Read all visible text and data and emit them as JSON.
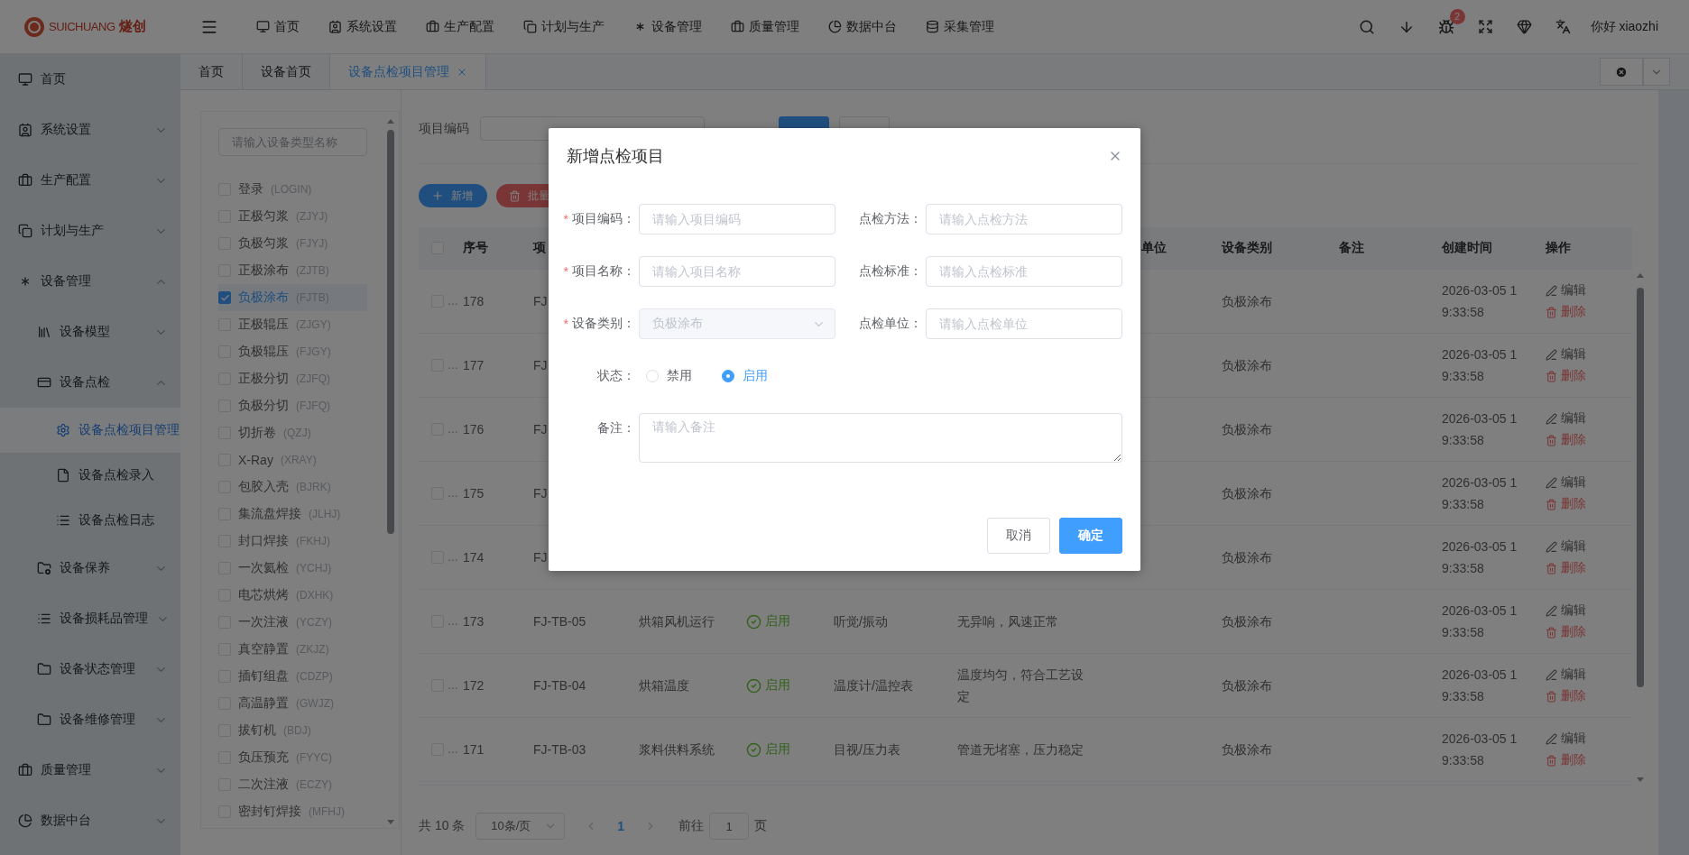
{
  "header": {
    "logo": {
      "latin": "SUICHUANG",
      "cjk": "燧创"
    },
    "nav": [
      "首页",
      "系统设置",
      "生产配置",
      "计划与生产",
      "设备管理",
      "质量管理",
      "数据中台",
      "采集管理"
    ],
    "notification_count": "2",
    "greeting": "你好 xiaozhi"
  },
  "sidebar": {
    "items": [
      {
        "label": "首页",
        "selected": false
      },
      {
        "label": "系统设置",
        "expanded": false,
        "selected": false
      },
      {
        "label": "生产配置",
        "expanded": false,
        "selected": false
      },
      {
        "label": "计划与生产",
        "expanded": false,
        "selected": false
      },
      {
        "label": "设备管理",
        "expanded": true,
        "selected": false,
        "children": [
          {
            "label": "设备模型",
            "expanded": false,
            "selected": false
          },
          {
            "label": "设备点检",
            "expanded": true,
            "selected": false,
            "children": [
              {
                "label": "设备点检项目管理",
                "selected": true
              },
              {
                "label": "设备点检录入",
                "selected": false
              },
              {
                "label": "设备点检日志",
                "selected": false
              }
            ]
          },
          {
            "label": "设备保养",
            "expanded": false,
            "selected": false
          },
          {
            "label": "设备损耗品管理",
            "expanded": false,
            "selected": false
          },
          {
            "label": "设备状态管理",
            "expanded": false,
            "selected": false
          },
          {
            "label": "设备维修管理",
            "expanded": false,
            "selected": false
          }
        ]
      },
      {
        "label": "质量管理",
        "expanded": false,
        "selected": false
      },
      {
        "label": "数据中台",
        "expanded": false,
        "selected": false
      }
    ]
  },
  "tabs": [
    {
      "label": "首页",
      "selected": false,
      "closable": false
    },
    {
      "label": "设备首页",
      "selected": false,
      "closable": false
    },
    {
      "label": "设备点检项目管理",
      "selected": true,
      "closable": true
    }
  ],
  "category_tree": {
    "search": {
      "placeholder": "请输入设备类型名称"
    },
    "items": [
      {
        "name": "登录",
        "code": "(LOGIN)",
        "checked": false,
        "selected": false
      },
      {
        "name": "正极匀浆",
        "code": "(ZJYJ)",
        "checked": false,
        "selected": false
      },
      {
        "name": "负极匀浆",
        "code": "(FJYJ)",
        "checked": false,
        "selected": false
      },
      {
        "name": "正极涂布",
        "code": "(ZJTB)",
        "checked": false,
        "selected": false
      },
      {
        "name": "负极涂布",
        "code": "(FJTB)",
        "checked": true,
        "selected": true
      },
      {
        "name": "正极辊压",
        "code": "(ZJGY)",
        "checked": false,
        "selected": false
      },
      {
        "name": "负极辊压",
        "code": "(FJGY)",
        "checked": false,
        "selected": false
      },
      {
        "name": "正极分切",
        "code": "(ZJFQ)",
        "checked": false,
        "selected": false
      },
      {
        "name": "负极分切",
        "code": "(FJFQ)",
        "checked": false,
        "selected": false
      },
      {
        "name": "切折卷",
        "code": "(QZJ)",
        "checked": false,
        "selected": false
      },
      {
        "name": "X-Ray",
        "code": "(XRAY)",
        "checked": false,
        "selected": false
      },
      {
        "name": "包胶入壳",
        "code": "(BJRK)",
        "checked": false,
        "selected": false
      },
      {
        "name": "集流盘焊接",
        "code": "(JLHJ)",
        "checked": false,
        "selected": false
      },
      {
        "name": "封口焊接",
        "code": "(FKHJ)",
        "checked": false,
        "selected": false
      },
      {
        "name": "一次氦检",
        "code": "(YCHJ)",
        "checked": false,
        "selected": false
      },
      {
        "name": "电芯烘烤",
        "code": "(DXHK)",
        "checked": false,
        "selected": false
      },
      {
        "name": "一次注液",
        "code": "(YCZY)",
        "checked": false,
        "selected": false
      },
      {
        "name": "真空静置",
        "code": "(ZKJZ)",
        "checked": false,
        "selected": false
      },
      {
        "name": "插钉组盘",
        "code": "(CDZP)",
        "checked": false,
        "selected": false
      },
      {
        "name": "高温静置",
        "code": "(GWJZ)",
        "checked": false,
        "selected": false
      },
      {
        "name": "拔钉机",
        "code": "(BDJ)",
        "checked": false,
        "selected": false
      },
      {
        "name": "负压预充",
        "code": "(FYYC)",
        "checked": false,
        "selected": false
      },
      {
        "name": "二次注液",
        "code": "(ECZY)",
        "checked": false,
        "selected": false
      },
      {
        "name": "密封钉焊接",
        "code": "(MFHJ)",
        "checked": false,
        "selected": false
      }
    ]
  },
  "filter": {
    "label": "项目编码"
  },
  "actions": [
    {
      "label": "新增",
      "kind": "add"
    },
    {
      "label": "批量",
      "kind": "delete"
    }
  ],
  "table": {
    "all_checked": false,
    "columns": {
      "no": "序号",
      "code": "项",
      "unit": "单位",
      "category": "设备类别",
      "remark": "备注",
      "created": "创建时间",
      "actions": "操作"
    },
    "rows": [
      {
        "checked": false,
        "ellipsis": "…",
        "no": "178",
        "code": "FJ",
        "category": "负极涂布",
        "created": "2026-03-05 19:33:58",
        "edit": "编辑",
        "delete": "删除"
      },
      {
        "checked": false,
        "ellipsis": "…",
        "no": "177",
        "code": "FJ",
        "category": "负极涂布",
        "created": "2026-03-05 19:33:58",
        "edit": "编辑",
        "delete": "删除"
      },
      {
        "checked": false,
        "ellipsis": "…",
        "no": "176",
        "code": "FJ",
        "category": "负极涂布",
        "created": "2026-03-05 19:33:58",
        "edit": "编辑",
        "delete": "删除"
      },
      {
        "checked": false,
        "ellipsis": "…",
        "no": "175",
        "code": "FJ",
        "category": "负极涂布",
        "created": "2026-03-05 19:33:58",
        "edit": "编辑",
        "delete": "删除"
      },
      {
        "checked": false,
        "ellipsis": "…",
        "no": "174",
        "code": "FJ",
        "category": "负极涂布",
        "created": "2026-03-05 19:33:58",
        "edit": "编辑",
        "delete": "删除"
      },
      {
        "checked": false,
        "ellipsis": "…",
        "no": "173",
        "code": "FJ-TB-05",
        "name": "烘箱风机运行",
        "status": {
          "label": "启用",
          "on": true
        },
        "method": "听觉/振动",
        "standard": "无异响，风速正常",
        "category": "负极涂布",
        "created": "2026-03-05 19:33:58",
        "edit": "编辑",
        "delete": "删除"
      },
      {
        "checked": false,
        "ellipsis": "…",
        "no": "172",
        "code": "FJ-TB-04",
        "name": "烘箱温度",
        "status": {
          "label": "启用",
          "on": true
        },
        "method": "温度计/温控表",
        "standard": "温度均匀，符合工艺设定",
        "category": "负极涂布",
        "created": "2026-03-05 19:33:58",
        "edit": "编辑",
        "delete": "删除"
      },
      {
        "checked": false,
        "ellipsis": "…",
        "no": "171",
        "code": "FJ-TB-03",
        "name": "浆料供料系统",
        "status": {
          "label": "启用",
          "on": true
        },
        "method": "目视/压力表",
        "standard": "管道无堵塞，压力稳定",
        "category": "负极涂布",
        "created": "2026-03-05 19:33:58",
        "edit": "编辑",
        "delete": "删除"
      }
    ]
  },
  "pagination": {
    "total": "共 10 条",
    "page_size": "10条/页",
    "pages": [
      {
        "label": "1",
        "selected": true
      }
    ],
    "goto_label": "前往",
    "goto_value": "1",
    "goto_suffix": "页"
  },
  "dialog": {
    "title": "新增点检项目",
    "fields": [
      {
        "label": "项目编码：",
        "required_mark": "*",
        "kind": "input",
        "placeholder": "请输入项目编码"
      },
      {
        "label": "点检方法：",
        "kind": "input",
        "placeholder": "请输入点检方法"
      },
      {
        "label": "项目名称：",
        "required_mark": "*",
        "kind": "input",
        "placeholder": "请输入项目名称"
      },
      {
        "label": "点检标准：",
        "kind": "input",
        "placeholder": "请输入点检标准"
      },
      {
        "label": "设备类别：",
        "required_mark": "*",
        "kind": "select",
        "value": "负极涂布",
        "disabled": true
      },
      {
        "label": "点检单位：",
        "kind": "input",
        "placeholder": "请输入点检单位"
      }
    ],
    "status": {
      "label": "状态：",
      "options": [
        {
          "label": "禁用",
          "selected": false
        },
        {
          "label": "启用",
          "selected": true
        }
      ]
    },
    "remark": {
      "label": "备注：",
      "placeholder": "请输入备注"
    },
    "buttons": [
      {
        "label": "取消",
        "kind": "default"
      },
      {
        "label": "确定",
        "kind": "primary"
      }
    ]
  }
}
